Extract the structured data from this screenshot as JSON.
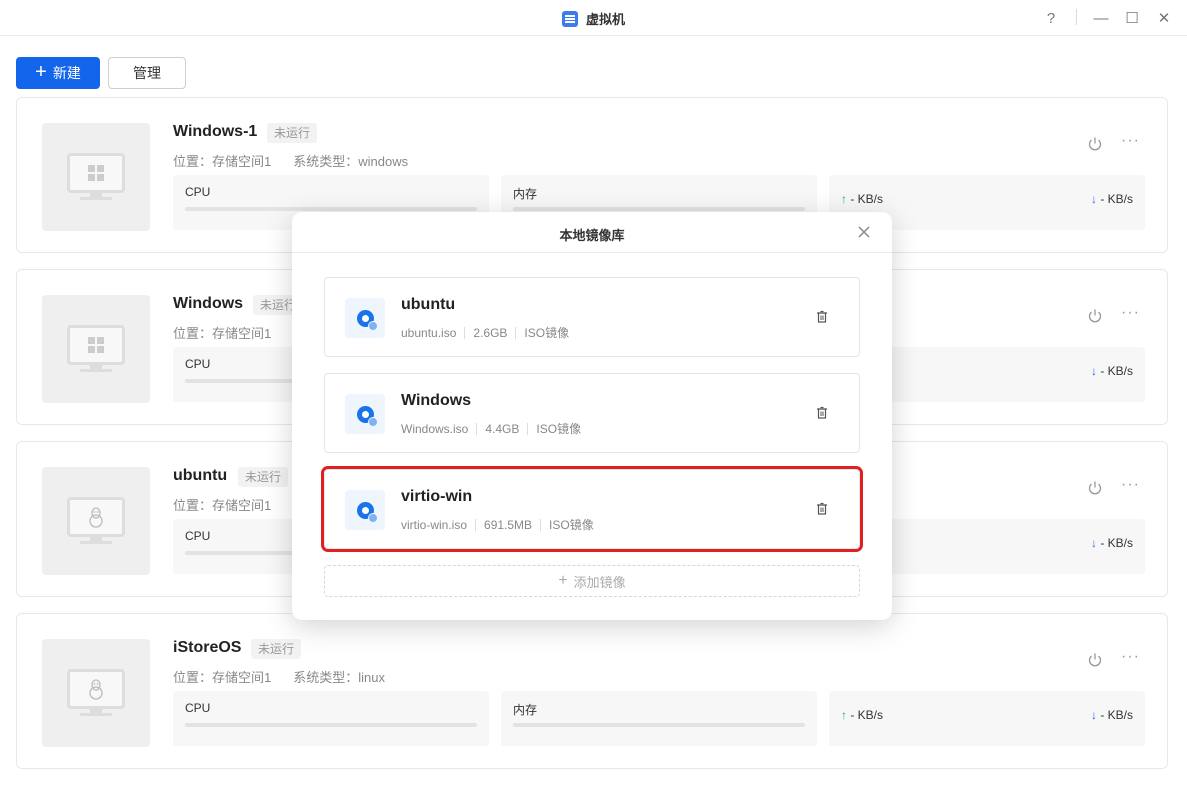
{
  "window": {
    "title": "虚拟机",
    "help": "?",
    "minimize": "—",
    "maximize": "☐",
    "close": "✕"
  },
  "toolbar": {
    "new_label": "新建",
    "manage_label": "管理"
  },
  "vms": [
    {
      "name": "Windows-1",
      "status": "未运行",
      "location": "位置：存储空间1",
      "os_type": "系统类型：windows",
      "os_icon": "windows-icon",
      "cpu_label": "CPU",
      "mem_label": "内存",
      "net_up": "- KB/s",
      "net_down": "- KB/s"
    },
    {
      "name": "Windows",
      "status": "未运行",
      "location": "位置：存储空间1",
      "os_icon": "windows-icon",
      "cpu_label": "CPU",
      "net_down": "- KB/s"
    },
    {
      "name": "ubuntu",
      "status": "未运行",
      "location": "位置：存储空间1",
      "os_icon": "linux-icon",
      "cpu_label": "CPU",
      "net_down": "- KB/s"
    },
    {
      "name": "iStoreOS",
      "status": "未运行",
      "location": "位置：存储空间1",
      "os_type": "系统类型：linux",
      "os_icon": "linux-icon",
      "cpu_label": "CPU",
      "mem_label": "内存",
      "net_up": "- KB/s",
      "net_down": "- KB/s"
    }
  ],
  "modal": {
    "title": "本地镜像库",
    "items": [
      {
        "name": "ubuntu",
        "file": "ubuntu.iso",
        "size": "2.6GB",
        "type": "ISO镜像"
      },
      {
        "name": "Windows",
        "file": "Windows.iso",
        "size": "4.4GB",
        "type": "ISO镜像"
      },
      {
        "name": "virtio-win",
        "file": "virtio-win.iso",
        "size": "691.5MB",
        "type": "ISO镜像"
      }
    ],
    "selected_index": 2,
    "add_label": "添加镜像"
  },
  "colors": {
    "primary": "#1366ec",
    "highlight": "#e02020",
    "net_up": "#20b26b",
    "net_down": "#2a6ee6"
  }
}
